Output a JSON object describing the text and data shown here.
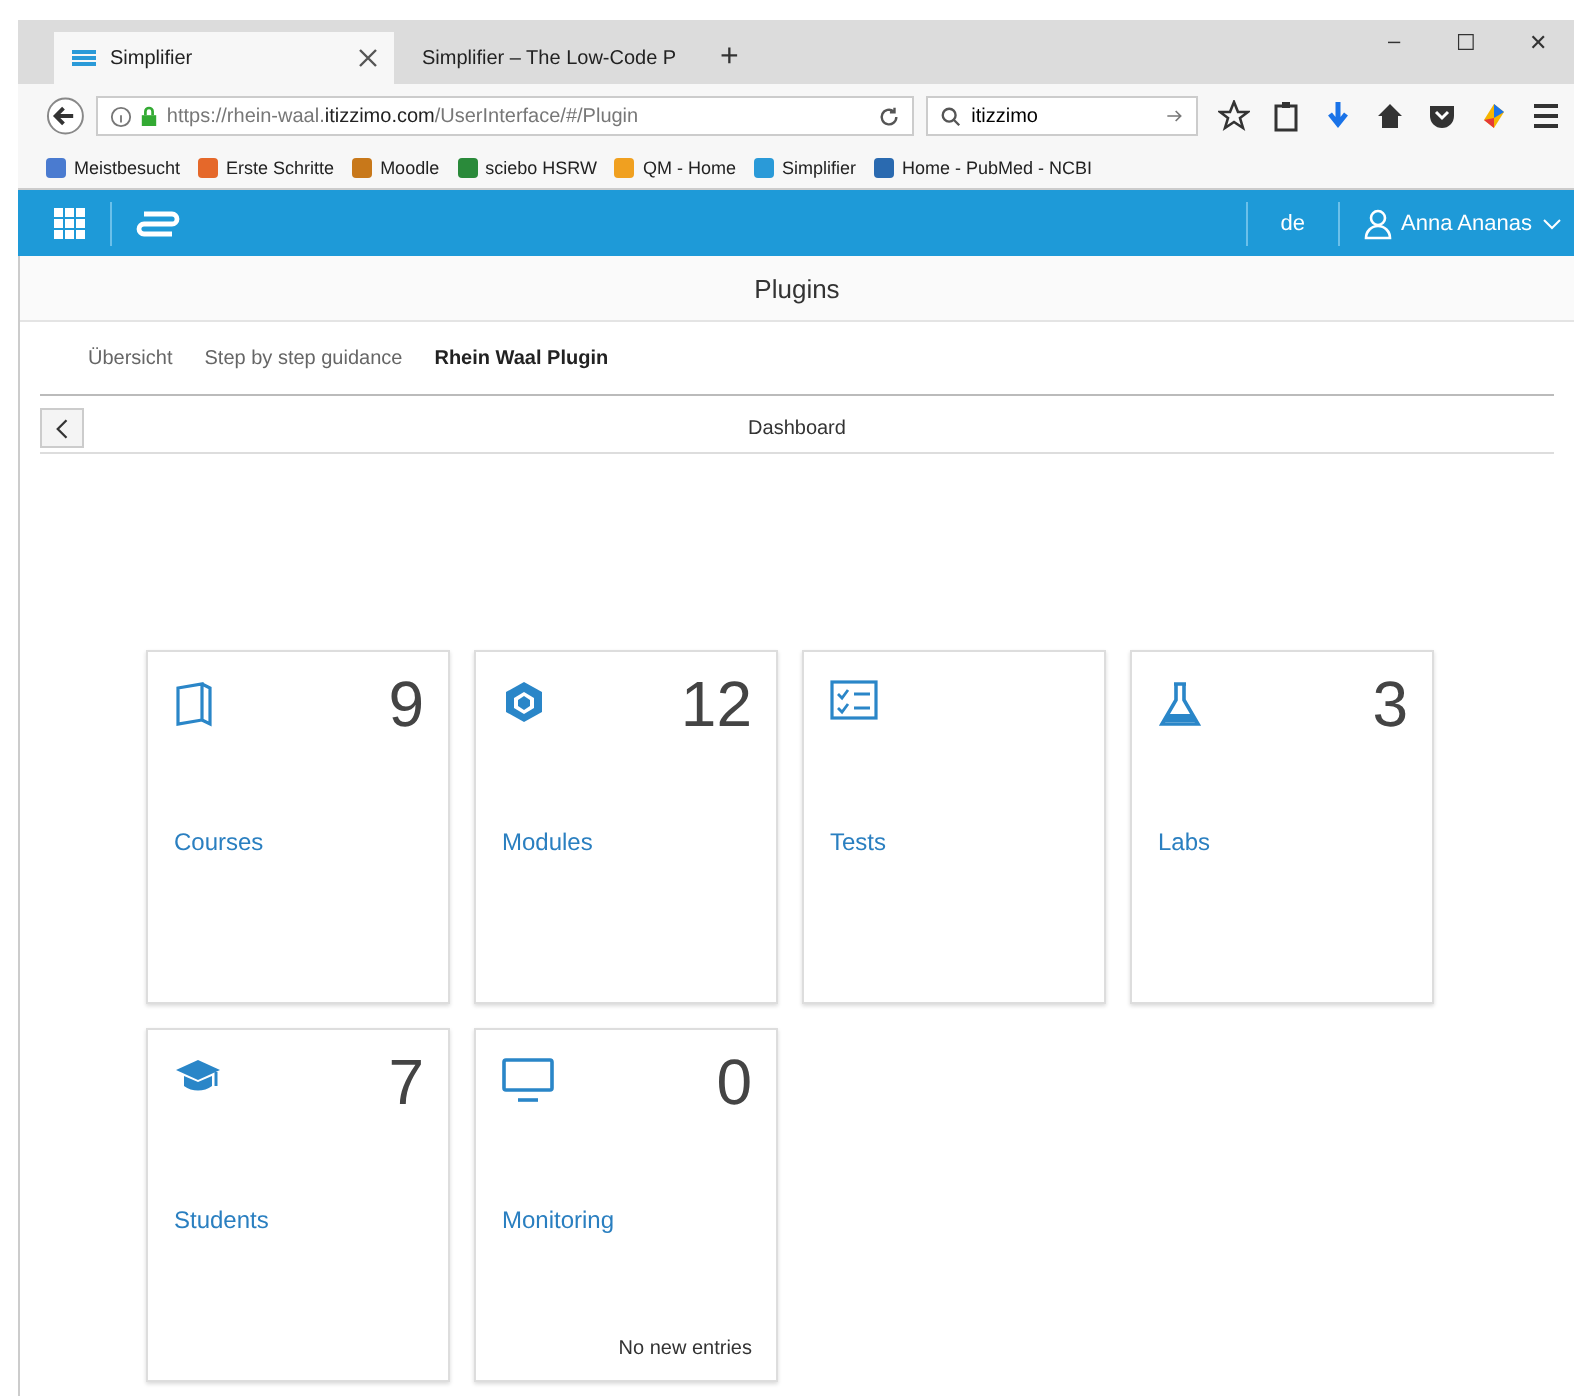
{
  "browser": {
    "tabs": [
      {
        "label": "Simplifier",
        "selected": true
      },
      {
        "label": "Simplifier – The Low-Code P",
        "selected": false
      }
    ],
    "new_tab": "+",
    "window_controls": [
      "–",
      "☐",
      "✕"
    ],
    "url": {
      "prefix": "https://rhein-waal.",
      "domain": "itizzimo.com",
      "path": "/UserInterface/#/Plugin"
    },
    "search": "itizzimo",
    "bookmarks": [
      "Meistbesucht",
      "Erste Schritte",
      "Moodle",
      "sciebo HSRW",
      "QM - Home",
      "Simplifier",
      "Home - PubMed - NCBI"
    ]
  },
  "app_header": {
    "language": "de",
    "user": "Anna Ananas"
  },
  "page_title": "Plugins",
  "nav_tabs": [
    {
      "label": "Übersicht",
      "selected": false
    },
    {
      "label": "Step by step guidance",
      "selected": false
    },
    {
      "label": "Rhein Waal Plugin",
      "selected": true
    }
  ],
  "subheader": {
    "title": "Dashboard"
  },
  "tiles": [
    {
      "title": "Courses",
      "count": "9"
    },
    {
      "title": "Modules",
      "count": "12"
    },
    {
      "title": "Tests"
    },
    {
      "title": "Labs",
      "count": "3"
    },
    {
      "title": "Students",
      "count": "7"
    },
    {
      "title": "Monitoring",
      "count": "0",
      "footer": "No new entries"
    }
  ]
}
